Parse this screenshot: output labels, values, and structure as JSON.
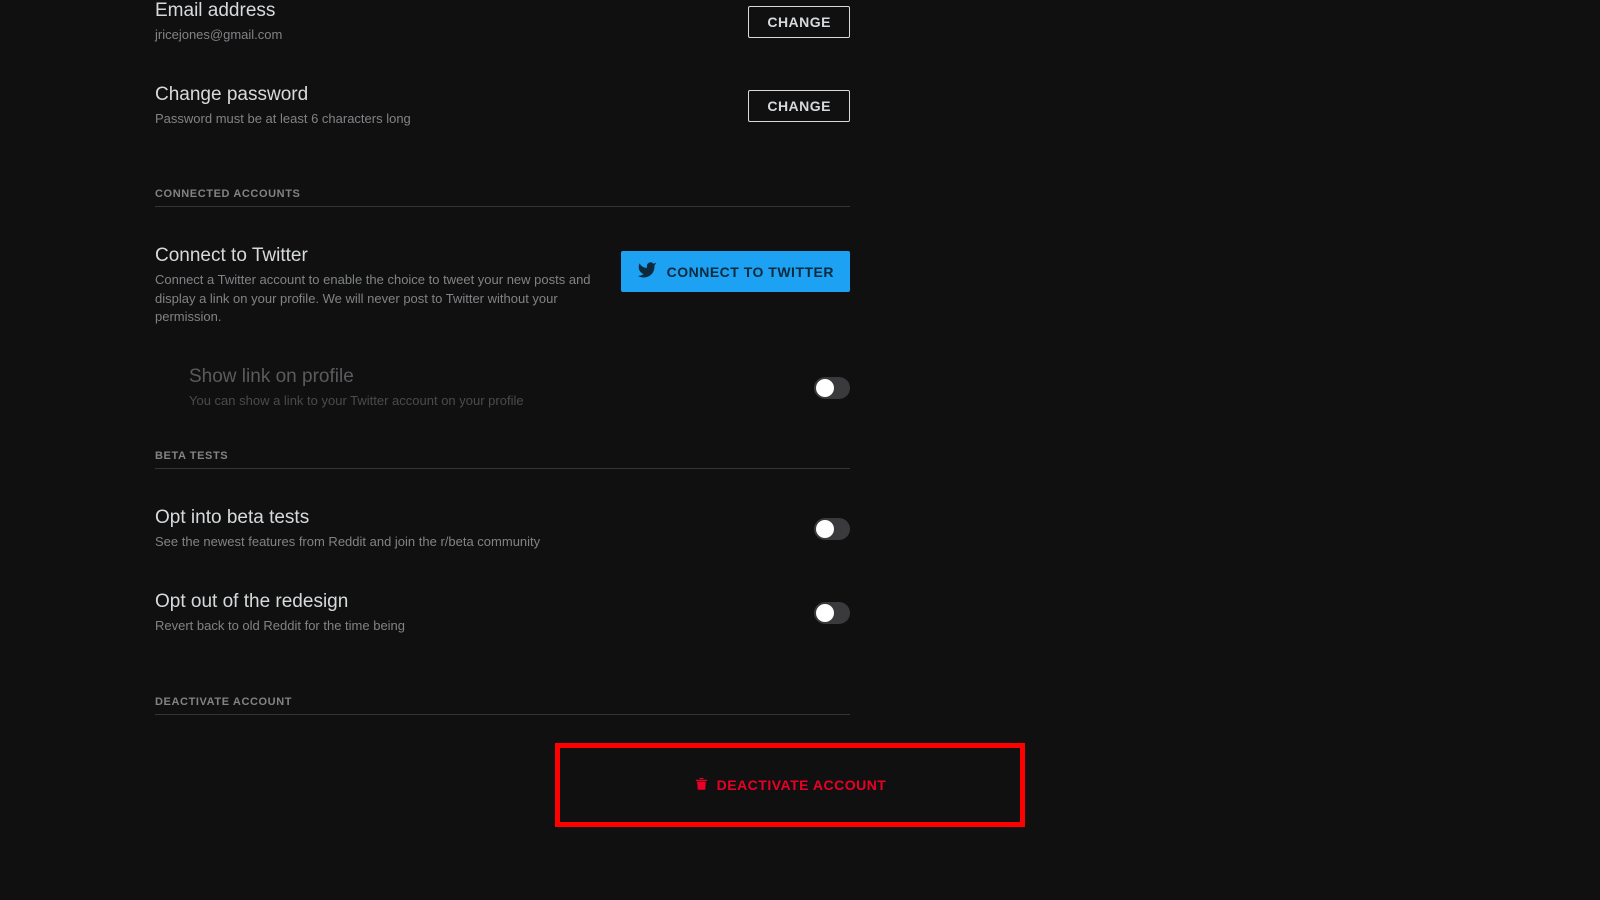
{
  "email": {
    "title": "Email address",
    "value": "jricejones@gmail.com",
    "button": "CHANGE"
  },
  "password": {
    "title": "Change password",
    "subtitle": "Password must be at least 6 characters long",
    "button": "CHANGE"
  },
  "sections": {
    "connected": "CONNECTED ACCOUNTS",
    "beta": "BETA TESTS",
    "deactivate": "DEACTIVATE ACCOUNT"
  },
  "twitter": {
    "title": "Connect to Twitter",
    "subtitle": "Connect a Twitter account to enable the choice to tweet your new posts and display a link on your profile. We will never post to Twitter without your permission.",
    "button": "CONNECT TO TWITTER",
    "showlink_title": "Show link on profile",
    "showlink_subtitle": "You can show a link to your Twitter account on your profile"
  },
  "beta": {
    "optin_title": "Opt into beta tests",
    "optin_subtitle": "See the newest features from Reddit and join the r/beta community",
    "optout_title": "Opt out of the redesign",
    "optout_subtitle": "Revert back to old Reddit for the time being"
  },
  "deactivate": {
    "button": "DEACTIVATE ACCOUNT"
  }
}
